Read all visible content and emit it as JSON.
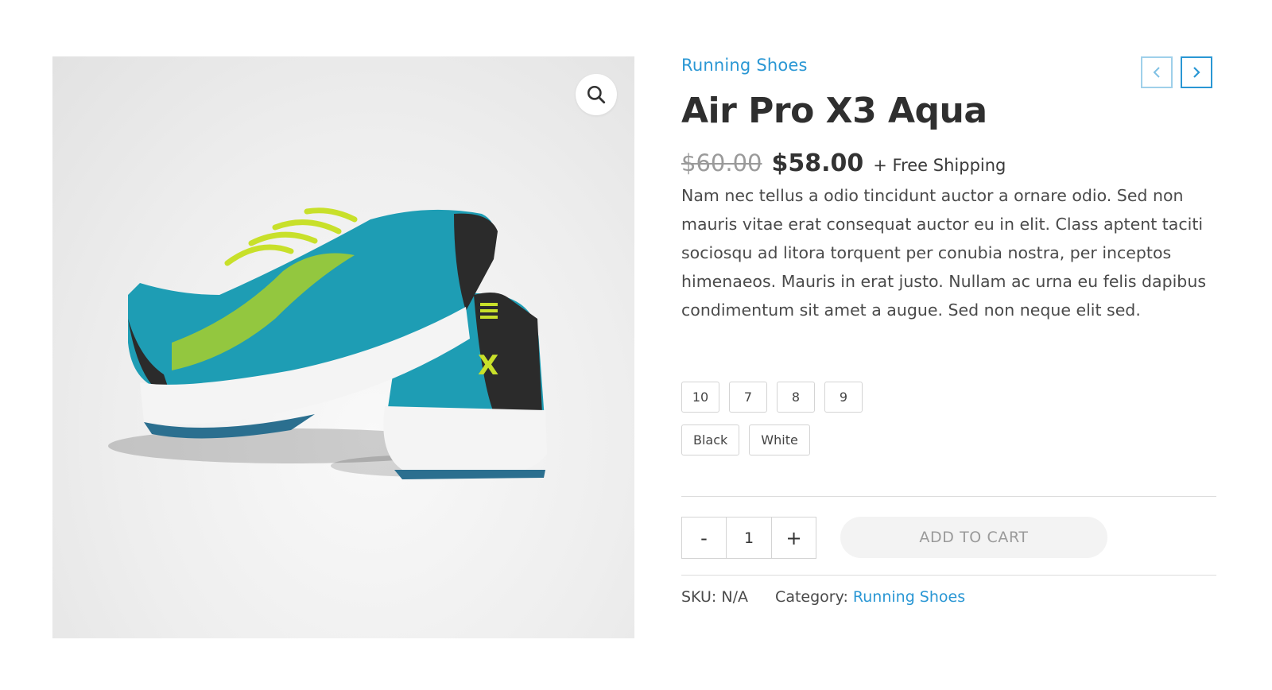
{
  "product": {
    "category_link": "Running Shoes",
    "title": "Air Pro X3 Aqua",
    "old_price": "$60.00",
    "price": "$58.00",
    "shipping": "+ Free Shipping",
    "description": "Nam nec tellus a odio tincidunt auctor a ornare odio. Sed non mauris vitae erat consequat auctor eu in elit. Class aptent taciti sociosqu ad litora torquent per conubia nostra, per inceptos himenaeos. Mauris in erat justo. Nullam ac urna eu felis dapibus condimentum sit amet a augue. Sed non neque elit sed."
  },
  "sizes": [
    "10",
    "7",
    "8",
    "9"
  ],
  "colors": [
    "Black",
    "White"
  ],
  "quantity": {
    "minus": "-",
    "value": "1",
    "plus": "+"
  },
  "add_to_cart": "ADD TO CART",
  "meta": {
    "sku_label": "SKU:",
    "sku_value": "N/A",
    "category_label": "Category:",
    "category_value": "Running Shoes"
  },
  "icons": {
    "zoom": "magnifier-icon",
    "prev": "chevron-left-icon",
    "next": "chevron-right-icon"
  },
  "colors_theme": {
    "accent": "#2a97d4",
    "shoe_teal": "#1e9db4",
    "shoe_lime": "#c8e02a"
  }
}
